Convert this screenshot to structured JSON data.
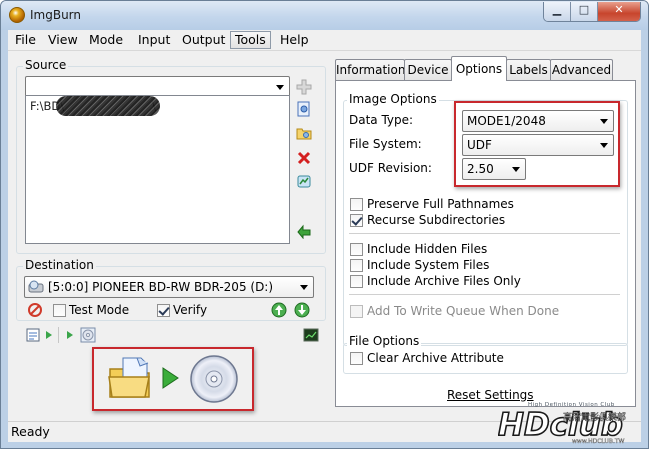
{
  "window": {
    "title": "ImgBurn"
  },
  "menu": [
    "File",
    "View",
    "Mode",
    "Input",
    "Output",
    "Tools",
    "Help"
  ],
  "source": {
    "label": "Source",
    "combo_value": "",
    "file_path": "F:\\BD\\",
    "file_path_tail": "\\"
  },
  "destination": {
    "label": "Destination",
    "drive": "[5:0:0] PIONEER BD-RW   BDR-205 (D:)",
    "test_mode_label": "Test Mode",
    "test_mode_checked": false,
    "verify_label": "Verify",
    "verify_checked": true
  },
  "tabs": [
    "Information",
    "Device",
    "Options",
    "Labels",
    "Advanced"
  ],
  "active_tab": "Options",
  "image_options": {
    "title": "Image Options",
    "data_type_label": "Data Type:",
    "data_type_value": "MODE1/2048",
    "file_system_label": "File System:",
    "file_system_value": "UDF",
    "udf_revision_label": "UDF Revision:",
    "udf_revision_value": "2.50"
  },
  "options_checks": [
    {
      "label": "Preserve Full Pathnames",
      "checked": false,
      "enabled": true
    },
    {
      "label": "Recurse Subdirectories",
      "checked": true,
      "enabled": true
    },
    {
      "label": "Include Hidden Files",
      "checked": false,
      "enabled": true
    },
    {
      "label": "Include System Files",
      "checked": false,
      "enabled": true
    },
    {
      "label": "Include Archive Files Only",
      "checked": false,
      "enabled": true
    },
    {
      "label": "Add To Write Queue When Done",
      "checked": false,
      "enabled": false
    }
  ],
  "file_options": {
    "title": "File Options",
    "clear_archive_label": "Clear Archive Attribute",
    "clear_archive_checked": false
  },
  "reset_label": "Reset Settings",
  "status": "Ready",
  "watermark": {
    "brand": "HDclub",
    "tagline": "High Definition Vision Club",
    "cjk": "高清電影俱樂部",
    "url": "www.HDCLUB.TW"
  },
  "colors": {
    "highlight_box": "#c8282d",
    "window_frame": "#bcd0e6"
  }
}
